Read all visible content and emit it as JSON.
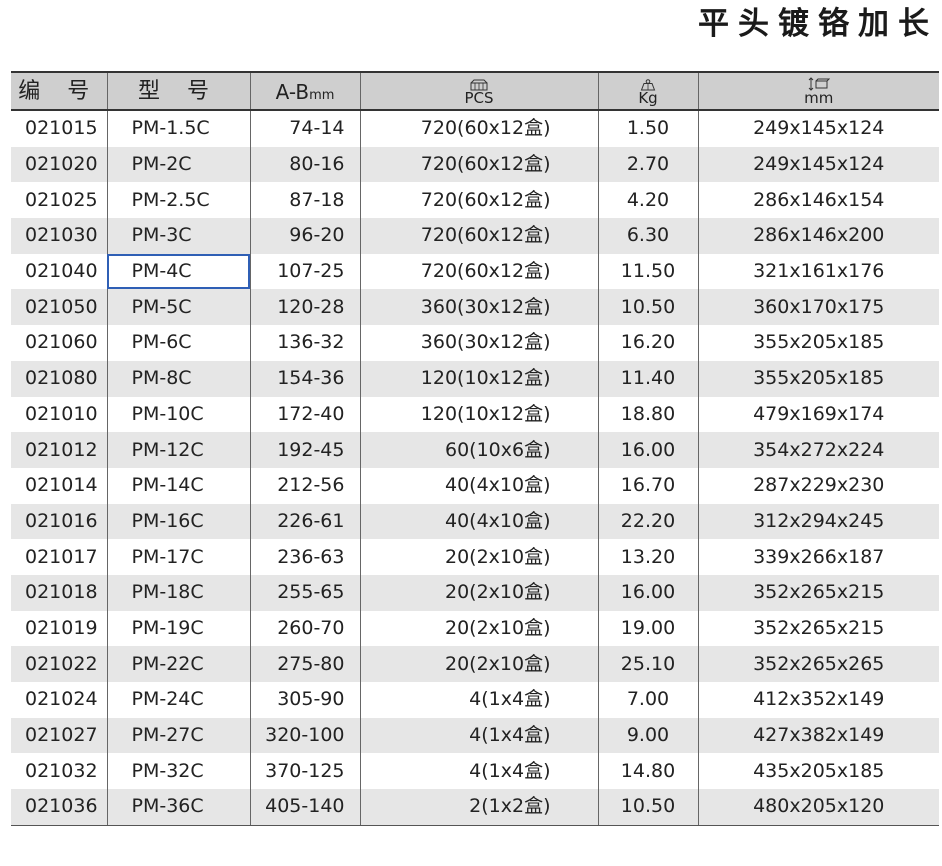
{
  "title": "平头镀铬加长",
  "headers": {
    "code": "编 号",
    "model": "型 号",
    "ab": "A-B",
    "ab_unit": "mm",
    "pcs": "PCS",
    "kg": "Kg",
    "mm": "mm"
  },
  "icons": {
    "pcs": "box-carton-icon",
    "kg": "weight-icon",
    "mm": "dimension-ruler-icon"
  },
  "colors": {
    "header_bg": "#cfcfcf",
    "stripe_bg": "#e6e6e6",
    "selection_border": "#2f5fb5"
  },
  "selected_row": 4,
  "rows": [
    {
      "code": "021015",
      "model": "PM-1.5C",
      "ab": "74-14",
      "pcs": "720(60x12盒)",
      "kg": "1.50",
      "mm": "249x145x124"
    },
    {
      "code": "021020",
      "model": "PM-2C",
      "ab": "80-16",
      "pcs": "720(60x12盒)",
      "kg": "2.70",
      "mm": "249x145x124"
    },
    {
      "code": "021025",
      "model": "PM-2.5C",
      "ab": "87-18",
      "pcs": "720(60x12盒)",
      "kg": "4.20",
      "mm": "286x146x154"
    },
    {
      "code": "021030",
      "model": "PM-3C",
      "ab": "96-20",
      "pcs": "720(60x12盒)",
      "kg": "6.30",
      "mm": "286x146x200"
    },
    {
      "code": "021040",
      "model": "PM-4C",
      "ab": "107-25",
      "pcs": "720(60x12盒)",
      "kg": "11.50",
      "mm": "321x161x176"
    },
    {
      "code": "021050",
      "model": "PM-5C",
      "ab": "120-28",
      "pcs": "360(30x12盒)",
      "kg": "10.50",
      "mm": "360x170x175"
    },
    {
      "code": "021060",
      "model": "PM-6C",
      "ab": "136-32",
      "pcs": "360(30x12盒)",
      "kg": "16.20",
      "mm": "355x205x185"
    },
    {
      "code": "021080",
      "model": "PM-8C",
      "ab": "154-36",
      "pcs": "120(10x12盒)",
      "kg": "11.40",
      "mm": "355x205x185"
    },
    {
      "code": "021010",
      "model": "PM-10C",
      "ab": "172-40",
      "pcs": "120(10x12盒)",
      "kg": "18.80",
      "mm": "479x169x174"
    },
    {
      "code": "021012",
      "model": "PM-12C",
      "ab": "192-45",
      "pcs": "60(10x6盒)",
      "kg": "16.00",
      "mm": "354x272x224"
    },
    {
      "code": "021014",
      "model": "PM-14C",
      "ab": "212-56",
      "pcs": "40(4x10盒)",
      "kg": "16.70",
      "mm": "287x229x230"
    },
    {
      "code": "021016",
      "model": "PM-16C",
      "ab": "226-61",
      "pcs": "40(4x10盒)",
      "kg": "22.20",
      "mm": "312x294x245"
    },
    {
      "code": "021017",
      "model": "PM-17C",
      "ab": "236-63",
      "pcs": "20(2x10盒)",
      "kg": "13.20",
      "mm": "339x266x187"
    },
    {
      "code": "021018",
      "model": "PM-18C",
      "ab": "255-65",
      "pcs": "20(2x10盒)",
      "kg": "16.00",
      "mm": "352x265x215"
    },
    {
      "code": "021019",
      "model": "PM-19C",
      "ab": "260-70",
      "pcs": "20(2x10盒)",
      "kg": "19.00",
      "mm": "352x265x215"
    },
    {
      "code": "021022",
      "model": "PM-22C",
      "ab": "275-80",
      "pcs": "20(2x10盒)",
      "kg": "25.10",
      "mm": "352x265x265"
    },
    {
      "code": "021024",
      "model": "PM-24C",
      "ab": "305-90",
      "pcs": "4(1x4盒)",
      "kg": "7.00",
      "mm": "412x352x149"
    },
    {
      "code": "021027",
      "model": "PM-27C",
      "ab": "320-100",
      "pcs": "4(1x4盒)",
      "kg": "9.00",
      "mm": "427x382x149"
    },
    {
      "code": "021032",
      "model": "PM-32C",
      "ab": "370-125",
      "pcs": "4(1x4盒)",
      "kg": "14.80",
      "mm": "435x205x185"
    },
    {
      "code": "021036",
      "model": "PM-36C",
      "ab": "405-140",
      "pcs": "2(1x2盒)",
      "kg": "10.50",
      "mm": "480x205x120"
    }
  ]
}
